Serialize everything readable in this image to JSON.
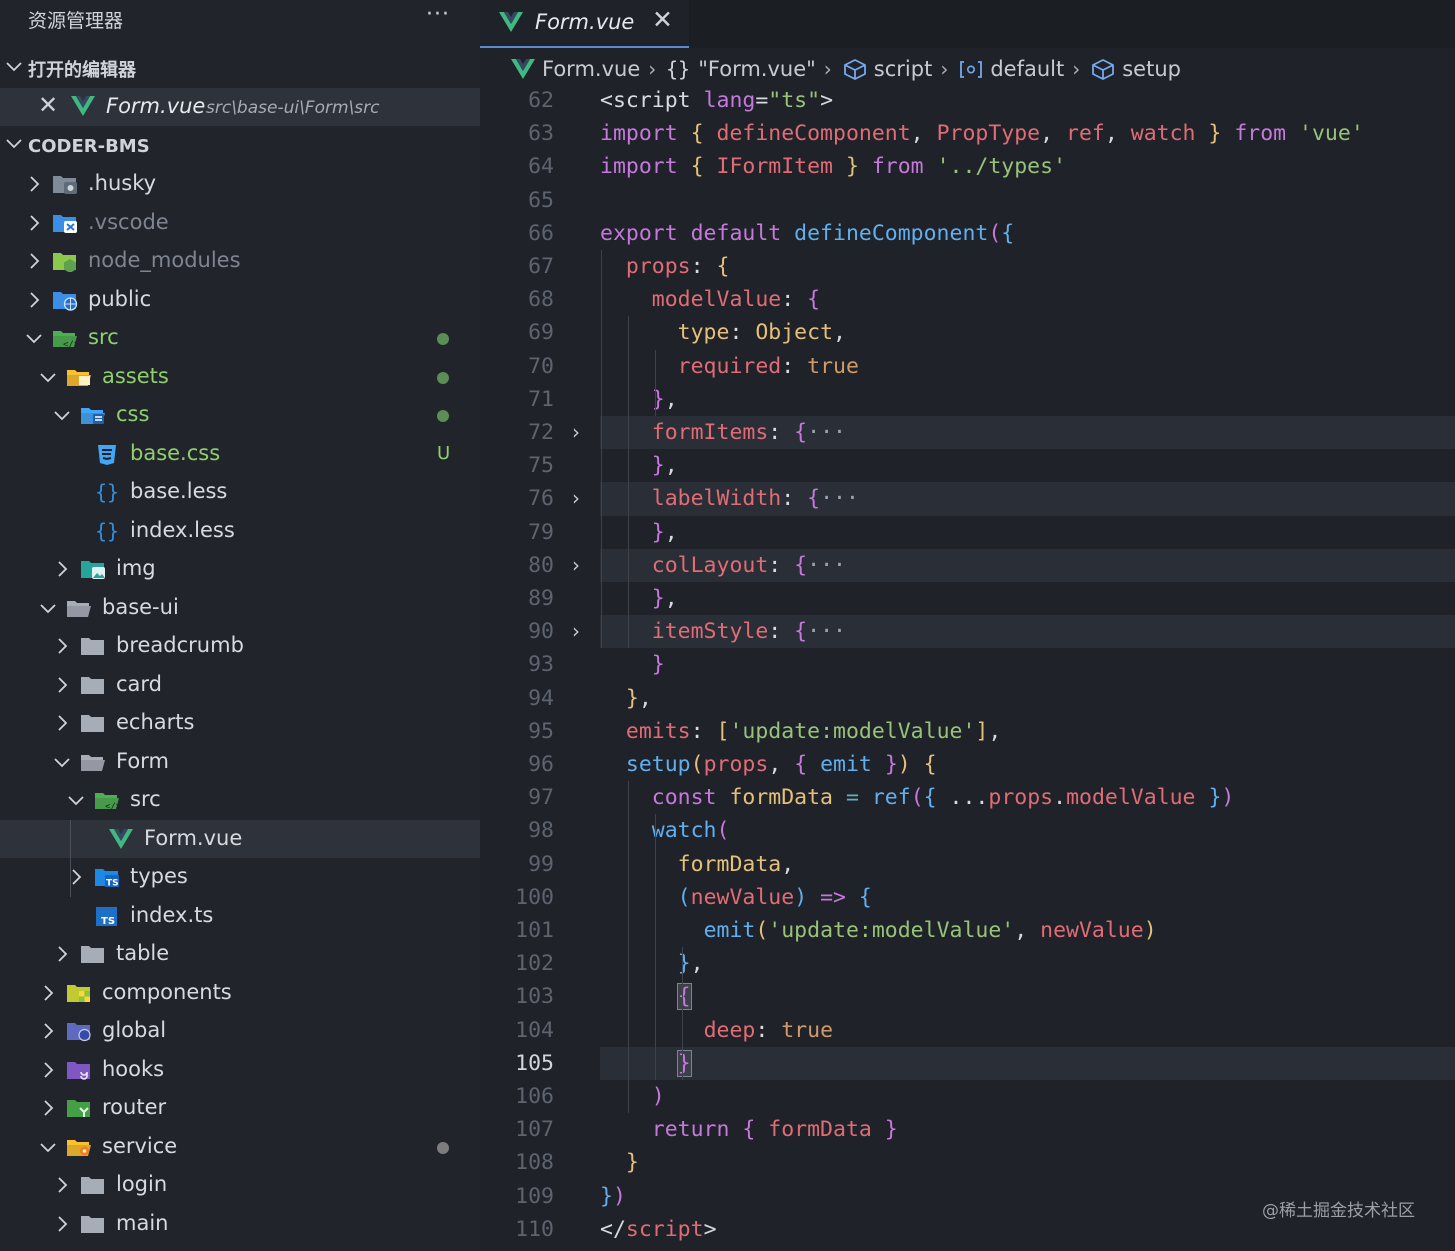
{
  "sidebar": {
    "title": "资源管理器",
    "more": "···",
    "open_editors": {
      "label": "打开的编辑器",
      "file": "Form.vue",
      "path": "src\\base-ui\\Form\\src"
    },
    "project": {
      "label": "CODER-BMS"
    },
    "tree": [
      {
        "name": ".husky",
        "icon": "husky-folder-icon",
        "depth": 1,
        "expanded": false
      },
      {
        "name": ".vscode",
        "icon": "vscode-folder-icon",
        "depth": 1,
        "expanded": false,
        "dim": true
      },
      {
        "name": "node_modules",
        "icon": "node-folder-icon",
        "depth": 1,
        "expanded": false,
        "dim": true
      },
      {
        "name": "public",
        "icon": "public-folder-icon",
        "depth": 1,
        "expanded": false
      },
      {
        "name": "src",
        "icon": "src-folder-icon",
        "depth": 1,
        "expanded": true,
        "green": true,
        "dot": "green"
      },
      {
        "name": "assets",
        "icon": "assets-folder-icon",
        "depth": 2,
        "expanded": true,
        "green": true,
        "dot": "green"
      },
      {
        "name": "css",
        "icon": "css-folder-icon",
        "depth": 3,
        "expanded": true,
        "green": true,
        "dot": "green"
      },
      {
        "name": "base.css",
        "icon": "css-file-icon",
        "depth": 4,
        "file": true,
        "green": true,
        "badge": "U"
      },
      {
        "name": "base.less",
        "icon": "less-file-icon",
        "depth": 4,
        "file": true
      },
      {
        "name": "index.less",
        "icon": "less-file-icon",
        "depth": 4,
        "file": true
      },
      {
        "name": "img",
        "icon": "image-folder-icon",
        "depth": 3,
        "expanded": false
      },
      {
        "name": "base-ui",
        "icon": "folder-open-icon",
        "depth": 2,
        "expanded": true
      },
      {
        "name": "breadcrumb",
        "icon": "folder-icon",
        "depth": 3,
        "expanded": false
      },
      {
        "name": "card",
        "icon": "folder-icon",
        "depth": 3,
        "expanded": false
      },
      {
        "name": "echarts",
        "icon": "folder-icon",
        "depth": 3,
        "expanded": false
      },
      {
        "name": "Form",
        "icon": "folder-open-icon",
        "depth": 3,
        "expanded": true
      },
      {
        "name": "src",
        "icon": "src-folder-icon",
        "depth": 4,
        "expanded": true
      },
      {
        "name": "Form.vue",
        "icon": "vue-file-icon",
        "depth": 5,
        "file": true,
        "selected": true
      },
      {
        "name": "types",
        "icon": "ts-folder-icon",
        "depth": 4,
        "expanded": false
      },
      {
        "name": "index.ts",
        "icon": "ts-file-icon",
        "depth": 4,
        "file": true
      },
      {
        "name": "table",
        "icon": "folder-icon",
        "depth": 3,
        "expanded": false
      },
      {
        "name": "components",
        "icon": "components-folder-icon",
        "depth": 2,
        "expanded": false
      },
      {
        "name": "global",
        "icon": "global-folder-icon",
        "depth": 2,
        "expanded": false
      },
      {
        "name": "hooks",
        "icon": "hooks-folder-icon",
        "depth": 2,
        "expanded": false
      },
      {
        "name": "router",
        "icon": "router-folder-icon",
        "depth": 2,
        "expanded": false
      },
      {
        "name": "service",
        "icon": "service-folder-icon",
        "depth": 2,
        "expanded": true,
        "dot": "gray"
      },
      {
        "name": "login",
        "icon": "folder-icon",
        "depth": 3,
        "expanded": false
      },
      {
        "name": "main",
        "icon": "folder-icon",
        "depth": 3,
        "expanded": false
      }
    ]
  },
  "editor": {
    "tab": {
      "name": "Form.vue",
      "close": "✕"
    },
    "breadcrumb": [
      {
        "text": "Form.vue",
        "icon": "vue-icon"
      },
      {
        "text": "\"Form.vue\"",
        "icon": "braces-icon"
      },
      {
        "text": "script",
        "icon": "cube-icon"
      },
      {
        "text": "default",
        "icon": "bracket-ref-icon"
      },
      {
        "text": "setup",
        "icon": "cube-icon"
      }
    ],
    "current_line": "105",
    "lines": [
      {
        "n": "62"
      },
      {
        "n": "63"
      },
      {
        "n": "64"
      },
      {
        "n": "65"
      },
      {
        "n": "66"
      },
      {
        "n": "67"
      },
      {
        "n": "68"
      },
      {
        "n": "69"
      },
      {
        "n": "70"
      },
      {
        "n": "71"
      },
      {
        "n": "72",
        "fold": true
      },
      {
        "n": "75"
      },
      {
        "n": "76",
        "fold": true
      },
      {
        "n": "79"
      },
      {
        "n": "80",
        "fold": true
      },
      {
        "n": "89"
      },
      {
        "n": "90",
        "fold": true
      },
      {
        "n": "93"
      },
      {
        "n": "94"
      },
      {
        "n": "95"
      },
      {
        "n": "96"
      },
      {
        "n": "97"
      },
      {
        "n": "98"
      },
      {
        "n": "99"
      },
      {
        "n": "100"
      },
      {
        "n": "101"
      },
      {
        "n": "102"
      },
      {
        "n": "103"
      },
      {
        "n": "104"
      },
      {
        "n": "105"
      },
      {
        "n": "106"
      },
      {
        "n": "107"
      },
      {
        "n": "108"
      },
      {
        "n": "109"
      },
      {
        "n": "110"
      }
    ],
    "code": [
      [
        [
          "w",
          "<script "
        ],
        [
          "k",
          "lang"
        ],
        [
          "w",
          "="
        ],
        [
          "s",
          "\"ts\""
        ],
        [
          "w",
          ">"
        ]
      ],
      [
        [
          "k",
          "import "
        ],
        [
          "br1",
          "{ "
        ],
        [
          "p",
          "defineComponent"
        ],
        [
          "w",
          ", "
        ],
        [
          "p",
          "PropType"
        ],
        [
          "w",
          ", "
        ],
        [
          "p",
          "ref"
        ],
        [
          "w",
          ", "
        ],
        [
          "p",
          "watch "
        ],
        [
          "br1",
          "} "
        ],
        [
          "k",
          "from "
        ],
        [
          "s",
          "'vue'"
        ]
      ],
      [
        [
          "k",
          "import "
        ],
        [
          "br1",
          "{ "
        ],
        [
          "p",
          "IFormItem "
        ],
        [
          "br1",
          "} "
        ],
        [
          "k",
          "from "
        ],
        [
          "s",
          "'../types'"
        ]
      ],
      [],
      [
        [
          "k",
          "export default "
        ],
        [
          "f",
          "defineComponent"
        ],
        [
          "br2",
          "("
        ],
        [
          "br3",
          "{"
        ]
      ],
      [
        [
          "w",
          "  "
        ],
        [
          "p",
          "props"
        ],
        [
          "w",
          ": "
        ],
        [
          "br1",
          "{"
        ]
      ],
      [
        [
          "w",
          "    "
        ],
        [
          "p",
          "modelValue"
        ],
        [
          "w",
          ": "
        ],
        [
          "br2",
          "{"
        ]
      ],
      [
        [
          "w",
          "      "
        ],
        [
          "y",
          "type"
        ],
        [
          "w",
          ": "
        ],
        [
          "y",
          "Object"
        ],
        [
          "w",
          ","
        ]
      ],
      [
        [
          "w",
          "      "
        ],
        [
          "p",
          "required"
        ],
        [
          "w",
          ": "
        ],
        [
          "o",
          "true"
        ]
      ],
      [
        [
          "w",
          "    "
        ],
        [
          "br2",
          "}"
        ],
        [
          "w",
          ","
        ]
      ],
      [
        [
          "w",
          "    "
        ],
        [
          "p",
          "formItems"
        ],
        [
          "w",
          ": "
        ],
        [
          "br2",
          "{"
        ],
        [
          "g",
          "···"
        ]
      ],
      [
        [
          "w",
          "    "
        ],
        [
          "br2",
          "}"
        ],
        [
          "w",
          ","
        ]
      ],
      [
        [
          "w",
          "    "
        ],
        [
          "p",
          "labelWidth"
        ],
        [
          "w",
          ": "
        ],
        [
          "br2",
          "{"
        ],
        [
          "g",
          "···"
        ]
      ],
      [
        [
          "w",
          "    "
        ],
        [
          "br2",
          "}"
        ],
        [
          "w",
          ","
        ]
      ],
      [
        [
          "w",
          "    "
        ],
        [
          "p",
          "colLayout"
        ],
        [
          "w",
          ": "
        ],
        [
          "br2",
          "{"
        ],
        [
          "g",
          "···"
        ]
      ],
      [
        [
          "w",
          "    "
        ],
        [
          "br2",
          "}"
        ],
        [
          "w",
          ","
        ]
      ],
      [
        [
          "w",
          "    "
        ],
        [
          "p",
          "itemStyle"
        ],
        [
          "w",
          ": "
        ],
        [
          "br2",
          "{"
        ],
        [
          "g",
          "···"
        ]
      ],
      [
        [
          "w",
          "    "
        ],
        [
          "br2",
          "}"
        ]
      ],
      [
        [
          "w",
          "  "
        ],
        [
          "br1",
          "}"
        ],
        [
          "w",
          ","
        ]
      ],
      [
        [
          "w",
          "  "
        ],
        [
          "p",
          "emits"
        ],
        [
          "w",
          ": "
        ],
        [
          "br1",
          "["
        ],
        [
          "s",
          "'update:modelValue'"
        ],
        [
          "br1",
          "]"
        ],
        [
          "w",
          ","
        ]
      ],
      [
        [
          "w",
          "  "
        ],
        [
          "f",
          "setup"
        ],
        [
          "br1",
          "("
        ],
        [
          "p",
          "props"
        ],
        [
          "w",
          ", "
        ],
        [
          "br2",
          "{ "
        ],
        [
          "f",
          "emit "
        ],
        [
          "br2",
          "}"
        ],
        [
          "br1",
          ") "
        ],
        [
          "br1",
          "{"
        ]
      ],
      [
        [
          "w",
          "    "
        ],
        [
          "k",
          "const "
        ],
        [
          "y",
          "formData "
        ],
        [
          "c",
          "= "
        ],
        [
          "f",
          "ref"
        ],
        [
          "br2",
          "("
        ],
        [
          "br3",
          "{ "
        ],
        [
          "w",
          "..."
        ],
        [
          "p",
          "props"
        ],
        [
          "w",
          "."
        ],
        [
          "p",
          "modelValue "
        ],
        [
          "br3",
          "}"
        ],
        [
          "br2",
          ")"
        ]
      ],
      [
        [
          "w",
          "    "
        ],
        [
          "f",
          "watch"
        ],
        [
          "br2",
          "("
        ]
      ],
      [
        [
          "w",
          "      "
        ],
        [
          "y",
          "formData"
        ],
        [
          "w",
          ","
        ]
      ],
      [
        [
          "w",
          "      "
        ],
        [
          "br3",
          "("
        ],
        [
          "p",
          "newValue"
        ],
        [
          "br3",
          ") "
        ],
        [
          "k",
          "=> "
        ],
        [
          "br3",
          "{"
        ]
      ],
      [
        [
          "w",
          "        "
        ],
        [
          "f",
          "emit"
        ],
        [
          "br1",
          "("
        ],
        [
          "s",
          "'update:modelValue'"
        ],
        [
          "w",
          ", "
        ],
        [
          "p",
          "newValue"
        ],
        [
          "br1",
          ")"
        ]
      ],
      [
        [
          "w",
          "      "
        ],
        [
          "br3",
          "}"
        ],
        [
          "w",
          ","
        ]
      ],
      [
        [
          "w",
          "      "
        ],
        [
          "bx",
          "{"
        ]
      ],
      [
        [
          "w",
          "        "
        ],
        [
          "p",
          "deep"
        ],
        [
          "w",
          ": "
        ],
        [
          "o",
          "true"
        ]
      ],
      [
        [
          "w",
          "      "
        ],
        [
          "bx",
          "}"
        ]
      ],
      [
        [
          "w",
          "    "
        ],
        [
          "br2",
          ")"
        ]
      ],
      [
        [
          "w",
          "    "
        ],
        [
          "k",
          "return "
        ],
        [
          "br2",
          "{ "
        ],
        [
          "p",
          "formData "
        ],
        [
          "br2",
          "}"
        ]
      ],
      [
        [
          "w",
          "  "
        ],
        [
          "br1",
          "}"
        ]
      ],
      [
        [
          "br3",
          "}"
        ],
        [
          "br2",
          ")"
        ]
      ],
      [
        [
          "w",
          "</"
        ],
        [
          "p",
          "script"
        ],
        [
          "w",
          ">"
        ]
      ]
    ]
  },
  "watermark": "@稀土掘金技术社区"
}
